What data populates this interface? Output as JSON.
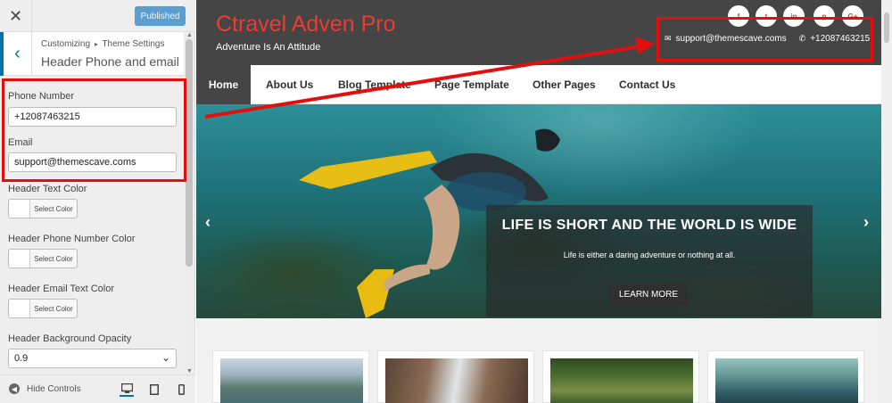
{
  "customizer": {
    "publish_label": "Published",
    "breadcrumb": {
      "root": "Customizing",
      "separator": "▸",
      "section": "Theme Settings"
    },
    "section_title": "Header Phone and email",
    "phone": {
      "label": "Phone Number",
      "value": "+12087463215"
    },
    "email": {
      "label": "Email",
      "value": "support@themescave.coms"
    },
    "color_controls": [
      {
        "label": "Header Text Color",
        "button": "Select Color"
      },
      {
        "label": "Header Phone Number Color",
        "button": "Select Color"
      },
      {
        "label": "Header Email Text Color",
        "button": "Select Color"
      }
    ],
    "opacity": {
      "label": "Header Background Opacity",
      "value": "0.9"
    },
    "footer": {
      "hide_label": "Hide Controls",
      "devices": [
        "desktop-icon",
        "tablet-icon",
        "mobile-icon"
      ]
    }
  },
  "site": {
    "title": "Ctravel Adven Pro",
    "tagline": "Adventure Is An Attitude",
    "social": [
      "f",
      "t",
      "in",
      "p",
      "G+"
    ],
    "email": "support@themescave.coms",
    "phone": "+12087463215",
    "nav": [
      "Home",
      "About Us",
      "Blog Template",
      "Page Template",
      "Other Pages",
      "Contact Us"
    ],
    "slider": {
      "title": "LIFE IS SHORT AND THE WORLD IS WIDE",
      "text": "Life is either a daring adventure or nothing at all.",
      "button": "LEARN MORE"
    }
  },
  "colors": {
    "annotation_red": "#e30f0f",
    "brand_red": "#ee3a33",
    "header_bg": "#454545",
    "wp_blue": "#0073aa",
    "publish_blue": "#5a9fd0"
  }
}
